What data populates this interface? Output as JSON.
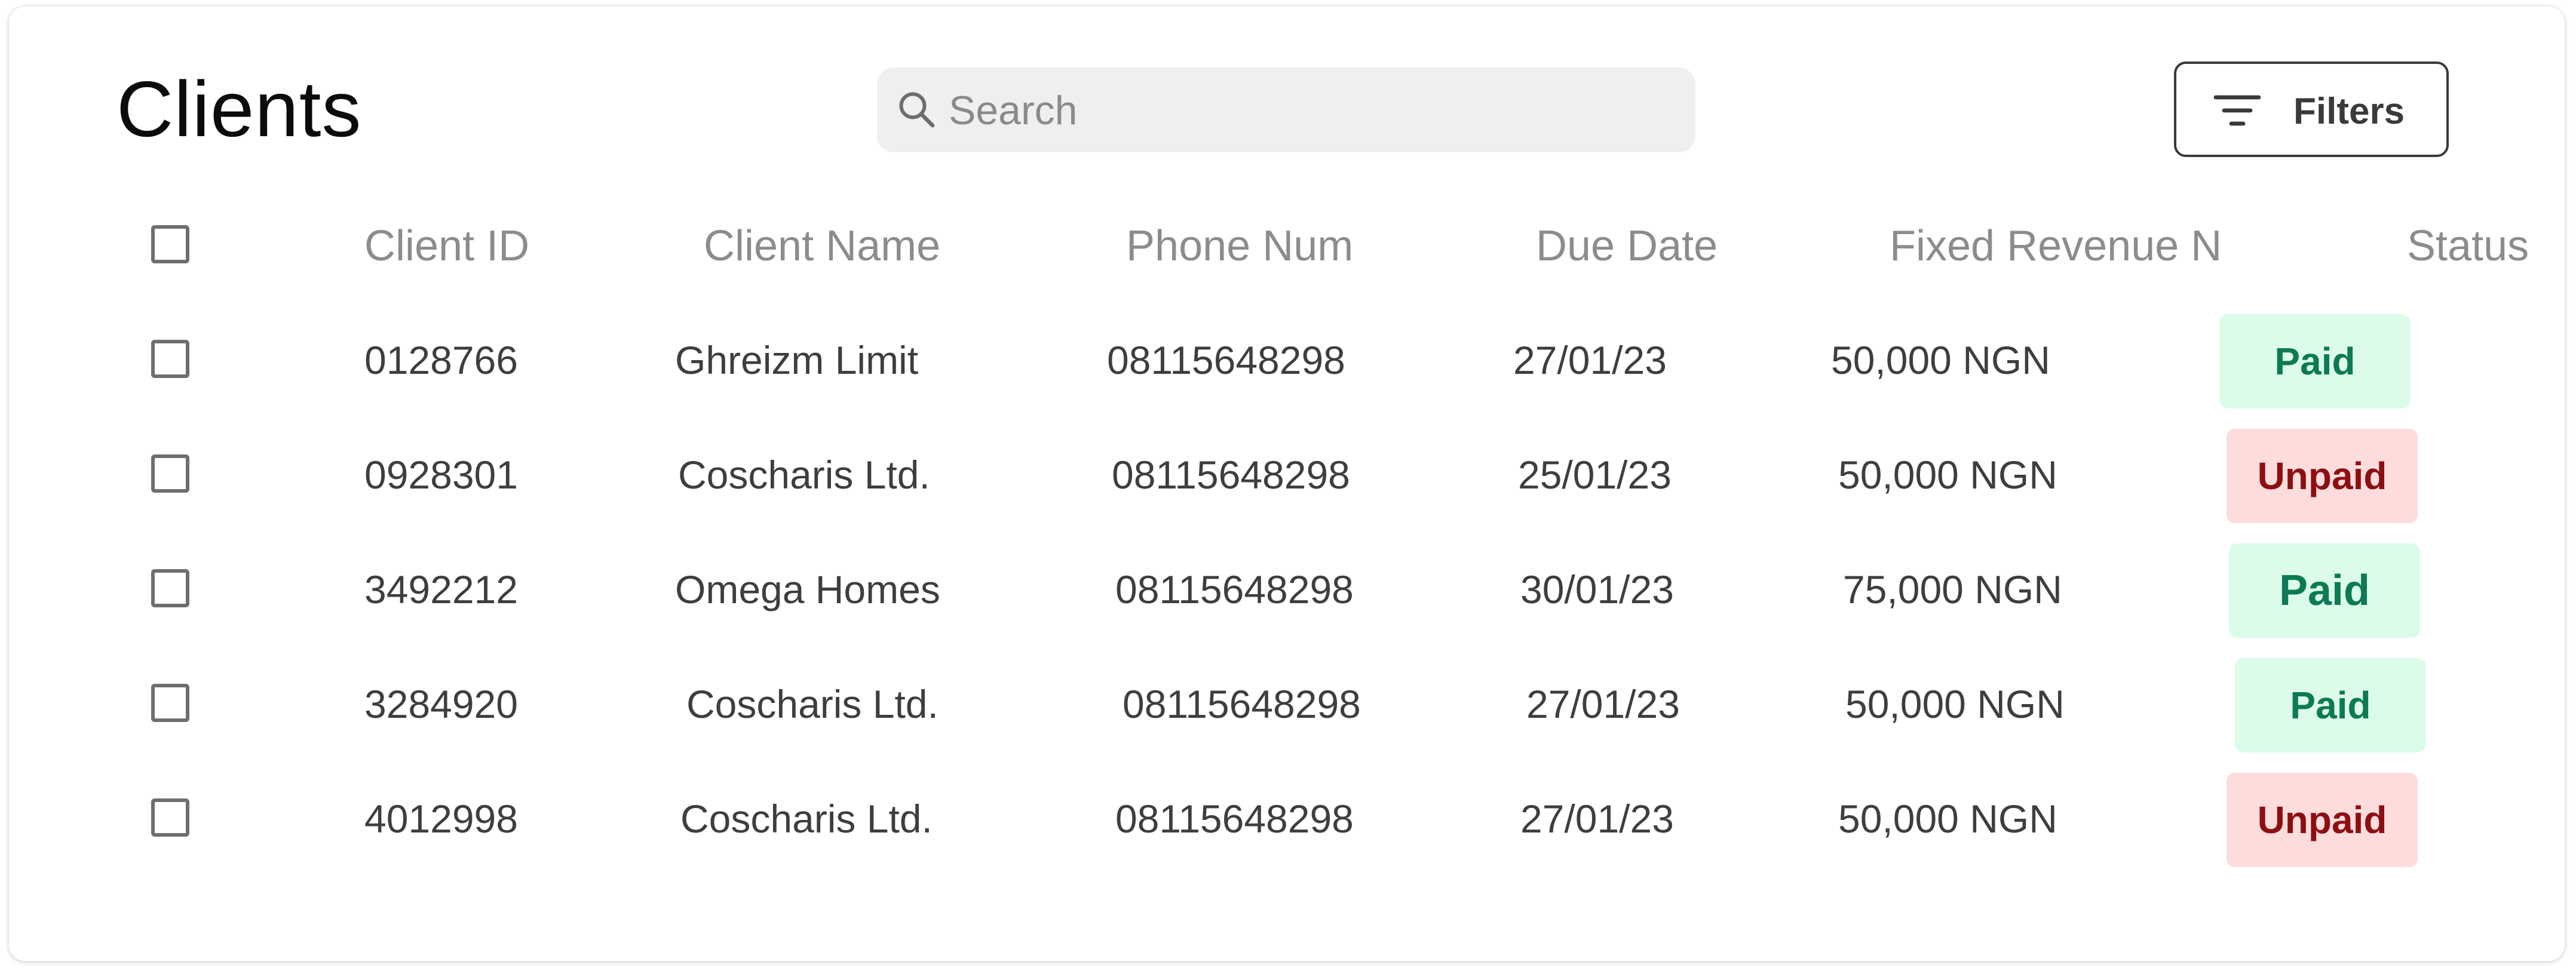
{
  "page": {
    "title": "Clients"
  },
  "search": {
    "placeholder": "Search",
    "value": ""
  },
  "filters": {
    "label": "Filters"
  },
  "table": {
    "columns": [
      "Client ID",
      "Client Name",
      "Phone Num",
      "Due Date",
      "Fixed Revenue N",
      "Status"
    ],
    "rows": [
      {
        "client_id": "0128766",
        "client_name": "Ghreizm Limit",
        "phone": "08115648298",
        "due_date": "27/01/23",
        "revenue": "50,000 NGN",
        "status": "Paid"
      },
      {
        "client_id": "0928301",
        "client_name": "Coscharis Ltd.",
        "phone": "08115648298",
        "due_date": "25/01/23",
        "revenue": "50,000 NGN",
        "status": "Unpaid"
      },
      {
        "client_id": "3492212",
        "client_name": "Omega Homes",
        "phone": "08115648298",
        "due_date": "30/01/23",
        "revenue": "75,000 NGN",
        "status": "Paid"
      },
      {
        "client_id": "3284920",
        "client_name": "Coscharis Ltd.",
        "phone": "08115648298",
        "due_date": "27/01/23",
        "revenue": "50,000 NGN",
        "status": "Paid"
      },
      {
        "client_id": "4012998",
        "client_name": "Coscharis Ltd.",
        "phone": "08115648298",
        "due_date": "27/01/23",
        "revenue": "50,000 NGN",
        "status": "Unpaid"
      }
    ]
  },
  "colors": {
    "paid_bg": "#dcfce9",
    "paid_text": "#0c7a54",
    "unpaid_bg": "#fddcdc",
    "unpaid_text": "#8b0f12"
  },
  "icons": {
    "search": "search-icon",
    "filter": "filter-lines-icon",
    "checkbox": "checkbox-unchecked-icon"
  }
}
